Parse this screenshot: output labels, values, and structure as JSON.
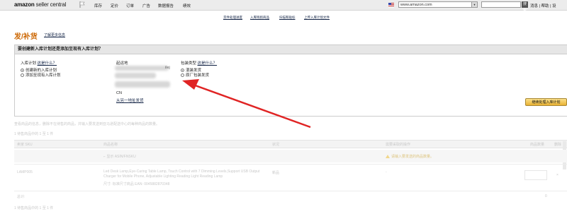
{
  "header": {
    "logo_bold": "amazon",
    "logo_thin": "seller central",
    "nav": [
      "库存",
      "定价",
      "订单",
      "广告",
      "数据报告",
      "绩效"
    ],
    "marketplace": "www.amazon.com",
    "search_button": "搜索",
    "toplinks": [
      "消息",
      "|",
      "帮助",
      "|",
      "设"
    ]
  },
  "sublinks": [
    "货件处理进度",
    "入库残损商品",
    "扫描和贴标",
    "上传入库计划文件"
  ],
  "page": {
    "title": "发/补货",
    "learn_more": "了解更多信息"
  },
  "panel": {
    "header": "要创建新入库计划还是添加至现有入库计划？",
    "plan_label": "入库计划",
    "plan_help": "这是什么？",
    "plan_options": [
      "创建新的入库计划",
      "添加至现有入库计划"
    ],
    "origin_label": "起运地",
    "origin_partial": "ilej",
    "origin_country": "CN",
    "origin_change": "从另一地址发货",
    "pack_label": "包装类型",
    "pack_help": "这是什么？",
    "pack_options": [
      "混装发货",
      "原厂包装发货"
    ],
    "confirm_button": "继续处理入库计划"
  },
  "faded": {
    "notice": "查看商品的信息，删除不在待售的商品，并输入要发送到亚马逊配送中心的每种商品的数量。",
    "count_top": "1 待售商品中的 1 至 1 件",
    "count_bottom": "1 待售商品中的 1 至 1 件",
    "columns": [
      "卖家 SKU",
      "商品名称",
      "状况",
      "需要采取的操作",
      "商品数量",
      "删除"
    ],
    "row1": {
      "asin": "显示 ASIN/FNSKU",
      "action": "请输入要发送的商品数量。"
    },
    "row2": {
      "sku": "LAMP005",
      "title": "Led Desk Lamp,Eye-Caring Table Lamp, Touch Control with 7 Dimming Levels,Support USB Output Charger for Mobile Phone, Adjustable Lighting Reading Light Reading Lamp",
      "meta": "尺寸: 标准尺寸商品   EAN: 0045882870348",
      "condition": "新品",
      "action": "-",
      "qty": "",
      "delete": "×"
    },
    "total_label": "总计:",
    "total_value": "0"
  },
  "colors": {
    "title_orange": "#cc6600",
    "link_blue": "#112244",
    "button_gold": "#e9b233",
    "arrow_red": "#e02424"
  }
}
